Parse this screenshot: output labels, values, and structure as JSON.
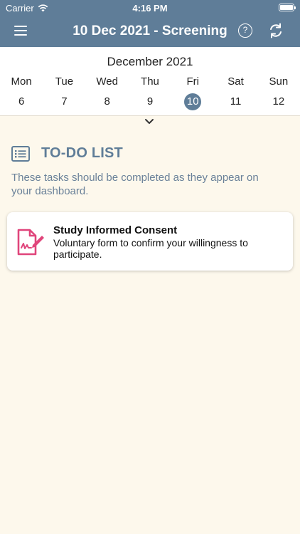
{
  "status_bar": {
    "carrier": "Carrier",
    "time": "4:16 PM"
  },
  "nav": {
    "title": "10 Dec 2021 - Screening",
    "help_glyph": "?",
    "icons": {
      "menu": "hamburger-menu-icon",
      "help": "help-circle-icon",
      "sync": "sync-icon"
    }
  },
  "calendar": {
    "month": "December 2021",
    "days": [
      {
        "dow": "Mon",
        "num": "6"
      },
      {
        "dow": "Tue",
        "num": "7"
      },
      {
        "dow": "Wed",
        "num": "8"
      },
      {
        "dow": "Thu",
        "num": "9"
      },
      {
        "dow": "Fri",
        "num": "10"
      },
      {
        "dow": "Sat",
        "num": "11"
      },
      {
        "dow": "Sun",
        "num": "12"
      }
    ],
    "selected": "10"
  },
  "todo": {
    "title": "TO-DO LIST",
    "description": "These tasks should be completed as they appear on your dashboard.",
    "tasks": [
      {
        "title": "Study Informed Consent",
        "description": "Voluntary form to confirm your willingness to participate.",
        "icon": "signature-document-icon"
      }
    ]
  },
  "colors": {
    "header": "#5f7d98",
    "background": "#fdf8ec",
    "accent_text": "#5f7d98",
    "task_icon": "#e0457b"
  }
}
